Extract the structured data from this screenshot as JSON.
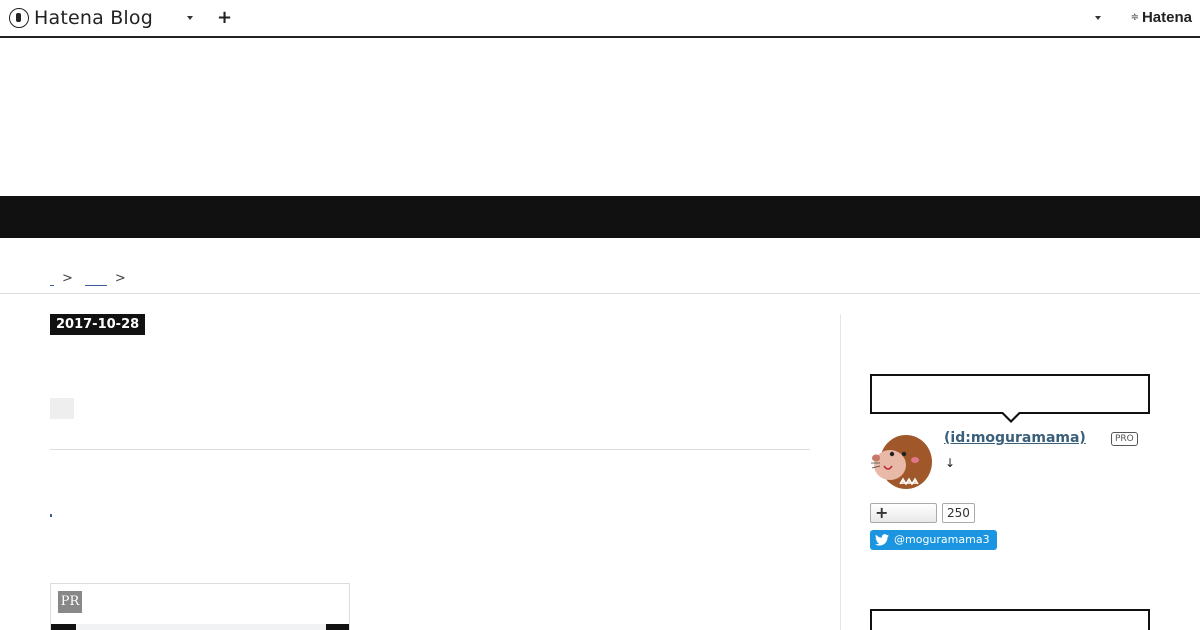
{
  "topbar": {
    "brand": "Hatena Blog",
    "add_icon": "plus-icon",
    "right_brand": "Hatena"
  },
  "breadcrumb": {
    "separator_1": ">",
    "separator_2": ">"
  },
  "entry": {
    "date": "2017-10-28"
  },
  "ad": {
    "pr_label": "PR"
  },
  "sidebar": {
    "profile_name": " (id:moguramama)",
    "pro_label": "PRO",
    "arrow": "↓",
    "star_count": "250",
    "twitter_handle": "@moguramama3"
  },
  "colors": {
    "accent_band": "#111111",
    "link": "#3a5f7a",
    "twitter": "#1b95e0"
  }
}
